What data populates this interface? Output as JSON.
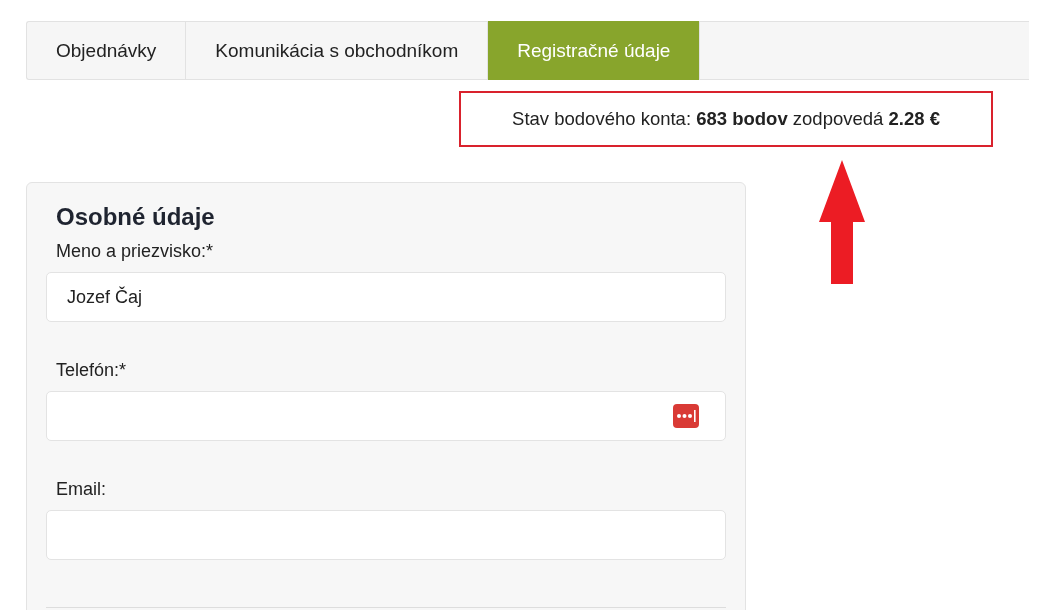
{
  "tabs": [
    {
      "label": "Objednávky",
      "selected": false
    },
    {
      "label": "Komunikácia s obchodníkom",
      "selected": false
    },
    {
      "label": "Registračné údaje",
      "selected": true
    }
  ],
  "points_balance": "Stav bodového konta: **683 bodov** zodpovedá **2.28 €**",
  "personal_data": {
    "title": "Osobné údaje",
    "fields": [
      {
        "label": "Meno a priezvisko:*",
        "value": "Jozef Čaj",
        "kind": "plain"
      },
      {
        "label": "Telefón:*",
        "kind": "autofill"
      },
      {
        "label": "Email:",
        "kind": "plain"
      }
    ]
  }
}
